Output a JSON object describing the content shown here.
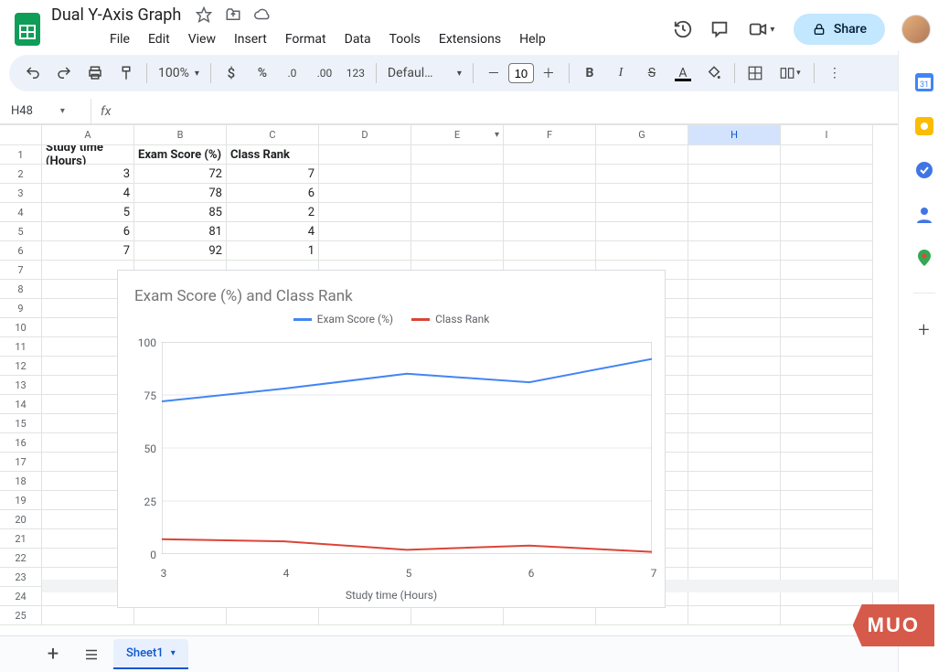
{
  "doc": {
    "title": "Dual Y-Axis Graph"
  },
  "menu": {
    "file": "File",
    "edit": "Edit",
    "view": "View",
    "insert": "Insert",
    "format": "Format",
    "data": "Data",
    "tools": "Tools",
    "extensions": "Extensions",
    "help": "Help"
  },
  "share": {
    "label": "Share"
  },
  "toolbar": {
    "zoom": "100%",
    "font": "Defaul…",
    "font_size": "10"
  },
  "namebox": {
    "ref": "H48"
  },
  "columns": [
    "A",
    "B",
    "C",
    "D",
    "E",
    "F",
    "G",
    "H",
    "I"
  ],
  "rows": [
    1,
    2,
    3,
    4,
    5,
    6,
    7,
    8,
    9,
    10,
    11,
    12,
    13,
    14,
    15,
    16,
    17,
    18,
    19,
    20,
    21,
    22,
    23,
    24,
    25
  ],
  "headers": {
    "A": "Study time (Hours)",
    "B": "Exam Score (%)",
    "C": "Class Rank"
  },
  "data_rows": [
    {
      "A": "3",
      "B": "72",
      "C": "7"
    },
    {
      "A": "4",
      "B": "78",
      "C": "6"
    },
    {
      "A": "5",
      "B": "85",
      "C": "2"
    },
    {
      "A": "6",
      "B": "81",
      "C": "4"
    },
    {
      "A": "7",
      "B": "92",
      "C": "1"
    }
  ],
  "chart_data": {
    "type": "line",
    "title": "Exam Score (%) and Class Rank",
    "xlabel": "Study time (Hours)",
    "ylabel": "",
    "x": [
      3,
      4,
      5,
      6,
      7
    ],
    "series": [
      {
        "name": "Exam Score (%)",
        "values": [
          72,
          78,
          85,
          81,
          92
        ],
        "color": "#4285f4"
      },
      {
        "name": "Class Rank",
        "values": [
          7,
          6,
          2,
          4,
          1
        ],
        "color": "#db4437"
      }
    ],
    "ylim": [
      0,
      100
    ],
    "yticks": [
      0,
      25,
      50,
      75,
      100
    ],
    "xticks": [
      3,
      4,
      5,
      6,
      7
    ],
    "legend_position": "top",
    "grid": true
  },
  "sheet": {
    "active": "Sheet1"
  },
  "selected_col": "H",
  "dropdown_col": "E",
  "branding": {
    "muo": "MUO"
  }
}
